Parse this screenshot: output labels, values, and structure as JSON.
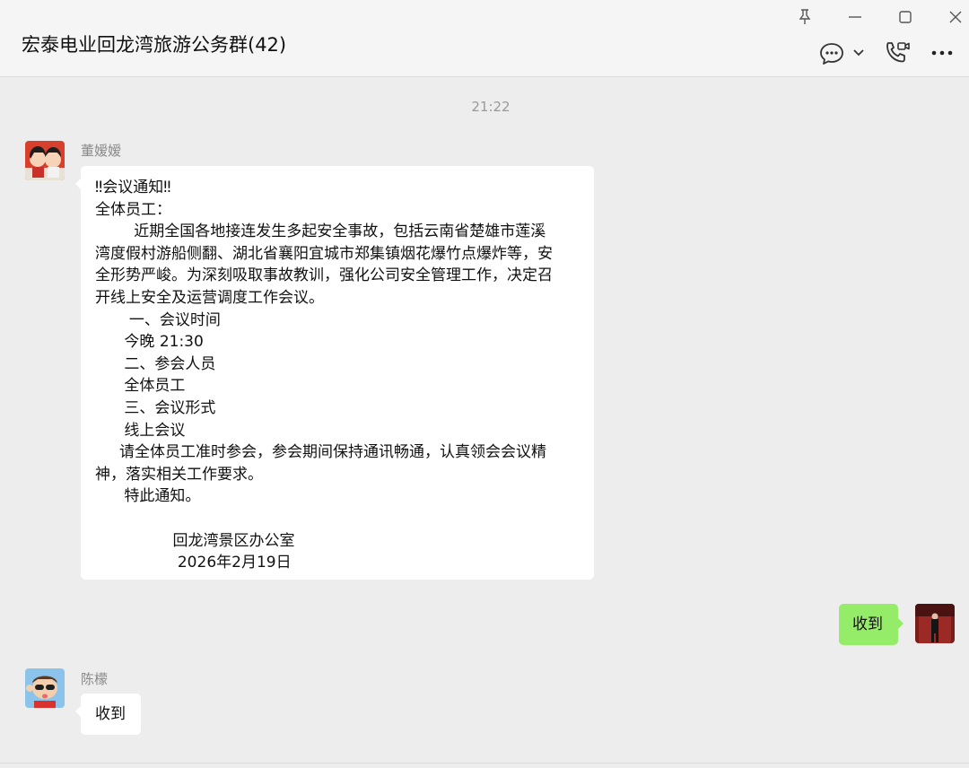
{
  "header": {
    "title": "宏泰电业回龙湾旅游公务群(42)"
  },
  "window_controls": {
    "pin_icon": "pin-icon",
    "minimize_icon": "minimize-icon",
    "maximize_icon": "maximize-icon",
    "close_icon": "close-icon"
  },
  "toolbar": {
    "chat_icon": "chat-bubble-icon",
    "dropdown_icon": "chevron-down-icon",
    "call_icon": "phone-video-icon",
    "more_icon": "more-icon"
  },
  "chat": {
    "timestamp": "21:22",
    "messages": [
      {
        "sender": "董嫒嫒",
        "lines": [
          "‼会议通知‼",
          "全体员工：",
          "        近期全国各地接连发生多起安全事故，包括云南省楚雄市莲溪",
          "湾度假村游船侧翻、湖北省襄阳宜城市郑集镇烟花爆竹点爆炸等，安",
          "全形势严峻。为深刻吸取事故教训，强化公司安全管理工作，决定召",
          "开线上安全及运营调度工作会议。",
          "       一、会议时间",
          "      今晚 21:30",
          "      二、参会人员",
          "      全体员工",
          "      三、会议形式",
          "      线上会议",
          "     请全体员工准时参会，参会期间保持通讯畅通，认真领会会议精",
          "神，落实相关工作要求。",
          "      特此通知。",
          "",
          "                回龙湾景区办公室",
          "                 2026年2月19日"
        ]
      },
      {
        "sender": "",
        "text": "收到",
        "self": true
      },
      {
        "sender": "陈檬",
        "text": "收到"
      }
    ]
  },
  "colors": {
    "self_bubble": "#95ec69",
    "other_bubble": "#ffffff",
    "background": "#ededed"
  }
}
